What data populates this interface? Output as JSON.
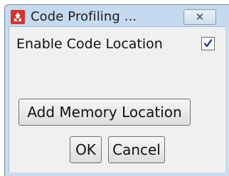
{
  "window": {
    "title": "Code Profiling ...",
    "close_glyph": "✕",
    "app_icon": "profiler-app-icon"
  },
  "dialog": {
    "enable_code_location_label": "Enable Code Location",
    "enable_code_location_checked": true,
    "add_memory_location_label": "Add Memory Location",
    "ok_label": "OK",
    "cancel_label": "Cancel"
  },
  "colors": {
    "title_bar": "#c6daef",
    "app_icon": "#d8322f",
    "client_area": "#f0f0f0",
    "check_mark": "#1c3f9a"
  }
}
